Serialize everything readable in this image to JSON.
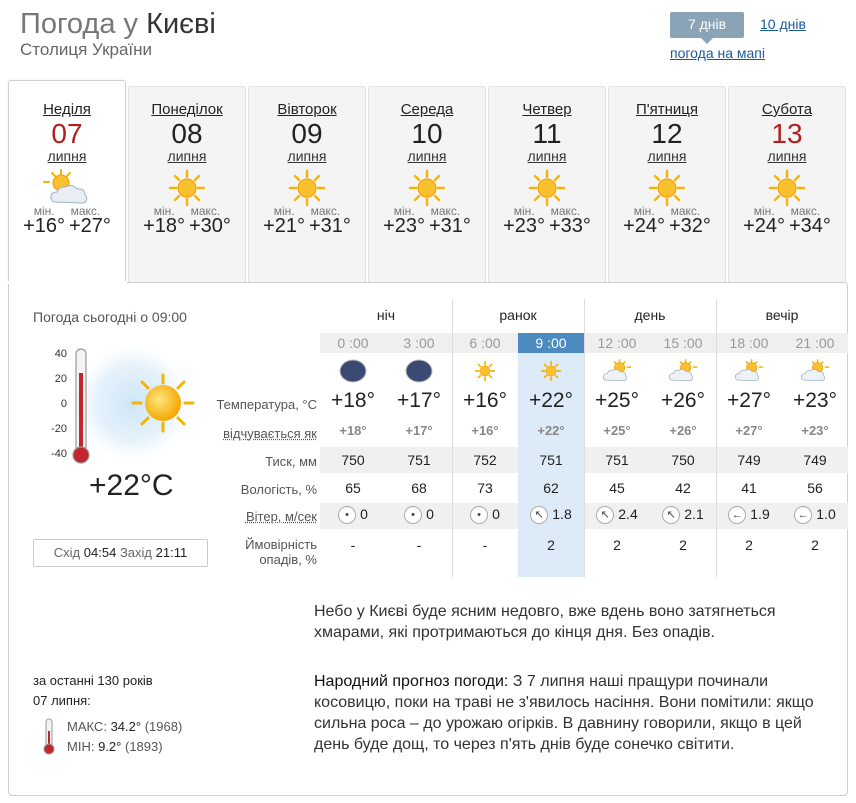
{
  "header": {
    "title_prefix": "Погода у",
    "title_city": "Києві",
    "subtitle": "Столиця України"
  },
  "view": {
    "btn_7": "7 днів",
    "link_10": "10 днів",
    "link_map": "погода на мапі"
  },
  "days": [
    {
      "name": "Неділя",
      "num": "07",
      "month": "липня",
      "icon": "partly-cloudy-icon",
      "min_label": "мін.",
      "max_label": "макс.",
      "min": "+16°",
      "max": "+27°",
      "red": true
    },
    {
      "name": "Понеділок",
      "num": "08",
      "month": "липня",
      "icon": "sun-icon",
      "min_label": "мін.",
      "max_label": "макс.",
      "min": "+18°",
      "max": "+30°",
      "red": false
    },
    {
      "name": "Вівторок",
      "num": "09",
      "month": "липня",
      "icon": "sun-icon",
      "min_label": "мін.",
      "max_label": "макс.",
      "min": "+21°",
      "max": "+31°",
      "red": false
    },
    {
      "name": "Середа",
      "num": "10",
      "month": "липня",
      "icon": "sun-icon",
      "min_label": "мін.",
      "max_label": "макс.",
      "min": "+23°",
      "max": "+31°",
      "red": false
    },
    {
      "name": "Четвер",
      "num": "11",
      "month": "липня",
      "icon": "sun-icon",
      "min_label": "мін.",
      "max_label": "макс.",
      "min": "+23°",
      "max": "+33°",
      "red": false
    },
    {
      "name": "П'ятниця",
      "num": "12",
      "month": "липня",
      "icon": "sun-icon",
      "min_label": "мін.",
      "max_label": "макс.",
      "min": "+24°",
      "max": "+32°",
      "red": false
    },
    {
      "name": "Субота",
      "num": "13",
      "month": "липня",
      "icon": "sun-icon",
      "min_label": "мін.",
      "max_label": "макс.",
      "min": "+24°",
      "max": "+34°",
      "red": true
    }
  ],
  "today": {
    "title": "Погода сьогодні о 09:00",
    "temp": "+22°C",
    "scale": [
      "40",
      "20",
      "0",
      "-20",
      "-40"
    ],
    "sunrise_label": "Схід",
    "sunrise": "04:54",
    "sunset_label": "Захід",
    "sunset": "21:11"
  },
  "periods": [
    "ніч",
    "ранок",
    "день",
    "вечір"
  ],
  "hours": [
    "0 :00",
    "3 :00",
    "6 :00",
    "9 :00",
    "12 :00",
    "15 :00",
    "18 :00",
    "21 :00"
  ],
  "hour_icons": [
    "moon-icon",
    "moon-icon",
    "sun-icon",
    "sun-icon",
    "sun-cloud-icon",
    "sun-cloud-icon",
    "sun-cloud-icon",
    "sun-cloud-icon"
  ],
  "labels": {
    "temperature": "Температура, °С",
    "feels": "відчувається як",
    "pressure": "Тиск, мм",
    "humidity": "Вологість, %",
    "wind": "Вітер, м/сек",
    "precip_1": "Ймовірність",
    "precip_2": "опадів, %"
  },
  "temps": [
    "+18°",
    "+17°",
    "+16°",
    "+22°",
    "+25°",
    "+26°",
    "+27°",
    "+23°"
  ],
  "feels": [
    "+18°",
    "+17°",
    "+16°",
    "+22°",
    "+25°",
    "+26°",
    "+27°",
    "+23°"
  ],
  "pressure": [
    "750",
    "751",
    "752",
    "751",
    "751",
    "750",
    "749",
    "749"
  ],
  "humidity": [
    "65",
    "68",
    "73",
    "62",
    "45",
    "42",
    "41",
    "56"
  ],
  "wind": [
    {
      "dir": "calm-icon",
      "glyph": "•",
      "v": "0"
    },
    {
      "dir": "calm-icon",
      "glyph": "•",
      "v": "0"
    },
    {
      "dir": "calm-icon",
      "glyph": "•",
      "v": "0"
    },
    {
      "dir": "wind-nw-icon",
      "glyph": "↖",
      "v": "1.8"
    },
    {
      "dir": "wind-nw-icon",
      "glyph": "↖",
      "v": "2.4"
    },
    {
      "dir": "wind-nw-icon",
      "glyph": "↖",
      "v": "2.1"
    },
    {
      "dir": "wind-w-icon",
      "glyph": "←",
      "v": "1.9"
    },
    {
      "dir": "wind-w-icon",
      "glyph": "←",
      "v": "1.0"
    }
  ],
  "precip": [
    "-",
    "-",
    "-",
    "2",
    "2",
    "2",
    "2",
    "2"
  ],
  "description": "Небо у Києві буде ясним недовго, вже вдень воно затягнеться хмарами, які протримаються до кінця дня. Без опадів.",
  "folk": {
    "label": "Народний прогноз погоди:",
    "text": " З 7 липня наші пращури починали косовицю, поки на траві не з'явилось насіння. Вони помітили: якщо сильна роса – до урожаю огірків. В давнину говорили, якщо в цей день буде дощ, то через п'ять днів буде сонечко світити."
  },
  "history": {
    "line1": "за останні 130 років",
    "line2": "07 липня:",
    "max_label": "МАКС:",
    "max_val": "34.2°",
    "max_year": "(1968)",
    "min_label": "МІН:",
    "min_val": "9.2°",
    "min_year": "(1893)"
  }
}
